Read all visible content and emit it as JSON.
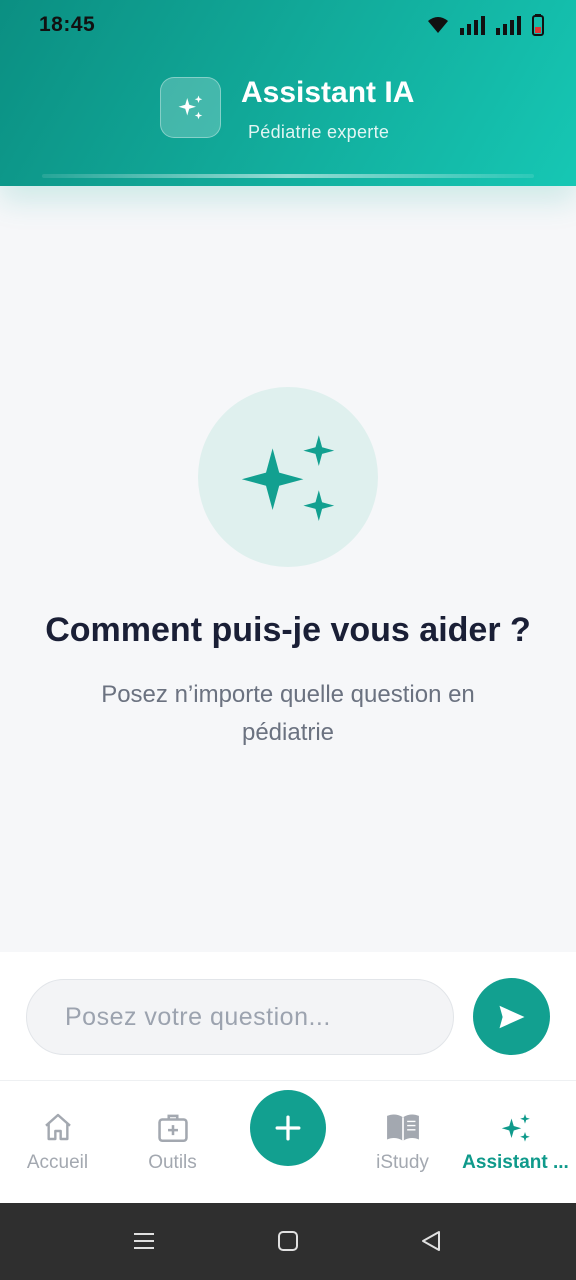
{
  "status_bar": {
    "time": "18:45"
  },
  "header": {
    "title": "Assistant IA",
    "subtitle": "Pédiatrie experte",
    "accent_color": "#12a090"
  },
  "hero": {
    "icon": "sparkles-icon",
    "title": "Comment puis-je vous aider ?",
    "subtitle": "Posez n’importe quelle question en pédiatrie"
  },
  "input": {
    "placeholder": "Posez votre question...",
    "value": ""
  },
  "bottom_nav": {
    "items": [
      {
        "label": "Accueil",
        "icon": "home-icon",
        "active": false
      },
      {
        "label": "Outils",
        "icon": "medical-kit-icon",
        "active": false
      },
      {
        "label": "iStudy",
        "icon": "book-icon",
        "active": false
      },
      {
        "label": "Assistant ...",
        "icon": "sparkles-icon",
        "active": true
      }
    ],
    "fab_icon": "plus-icon"
  }
}
